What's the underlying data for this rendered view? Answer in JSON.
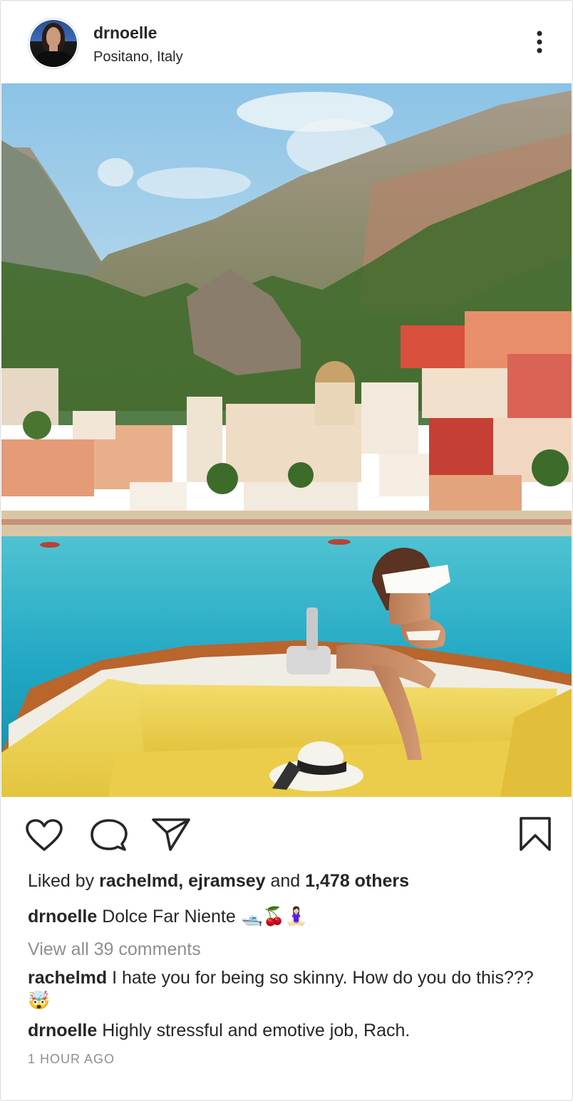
{
  "post": {
    "username": "drnoelle",
    "location": "Positano, Italy"
  },
  "icons": {
    "more": "more-vertical-icon",
    "like": "heart-icon",
    "comment": "comment-bubble-icon",
    "share": "paper-plane-icon",
    "save": "bookmark-icon"
  },
  "likes": {
    "prefix": "Liked by ",
    "names": "rachelmd, ejramsey",
    "conjunction": " and ",
    "others": "1,478 others"
  },
  "caption": {
    "username": "drnoelle",
    "text": " Dolce Far Niente 🛥️🍒🧘🏻‍♀️"
  },
  "view_all_comments": "View all 39 comments",
  "comments": [
    {
      "username": "rachelmd",
      "text": " I hate you for being so skinny. How do you do this??? 🤯"
    },
    {
      "username": "drnoelle",
      "text": " Highly stressful and emotive job, Rach."
    }
  ],
  "timestamp": "1 HOUR AGO",
  "colors": {
    "text": "#262626",
    "muted": "#8e8e8e",
    "border": "#dbdbdb"
  }
}
